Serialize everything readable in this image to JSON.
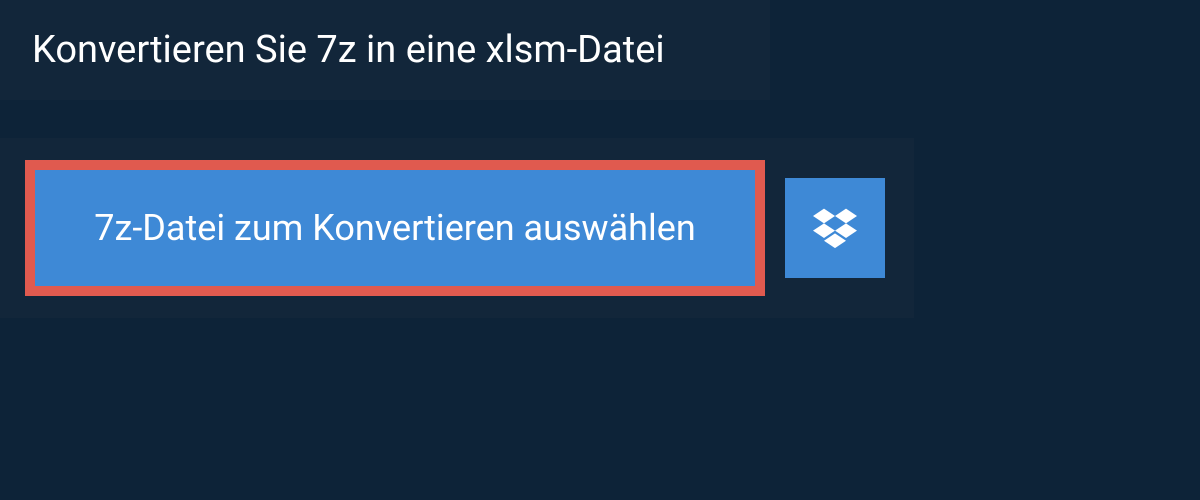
{
  "header": {
    "title": "Konvertieren Sie 7z in eine xlsm-Datei"
  },
  "actions": {
    "select_file_label": "7z-Datei zum Konvertieren auswählen",
    "dropbox_icon": "dropbox-icon"
  },
  "colors": {
    "background": "#0d2338",
    "panel": "#12263a",
    "button": "#3e89d6",
    "highlight_border": "#e05a4f",
    "text": "#ffffff"
  }
}
